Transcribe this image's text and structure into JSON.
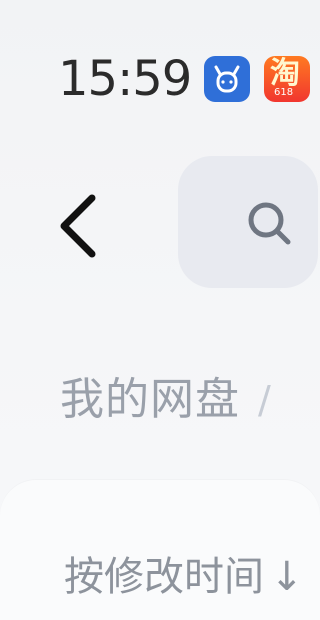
{
  "status_bar": {
    "time": "15:59",
    "apps": [
      {
        "name": "bull-app-icon",
        "color": "#2f6fd8"
      },
      {
        "name": "taobao-app-icon",
        "glyph": "淘",
        "caption": "618",
        "color": "#f1362f"
      }
    ]
  },
  "header": {
    "back_icon": "chevron-left-icon",
    "search_icon": "search-icon"
  },
  "breadcrumb": {
    "root_label": "我的网盘",
    "separator": "/"
  },
  "sort": {
    "label": "按修改时间",
    "arrow": "↓"
  },
  "colors": {
    "page_bg": "#f2f3f5",
    "text_muted": "#9aa0aa",
    "clock": "#2b2b2b",
    "search_bg": "#e8eaf0"
  }
}
